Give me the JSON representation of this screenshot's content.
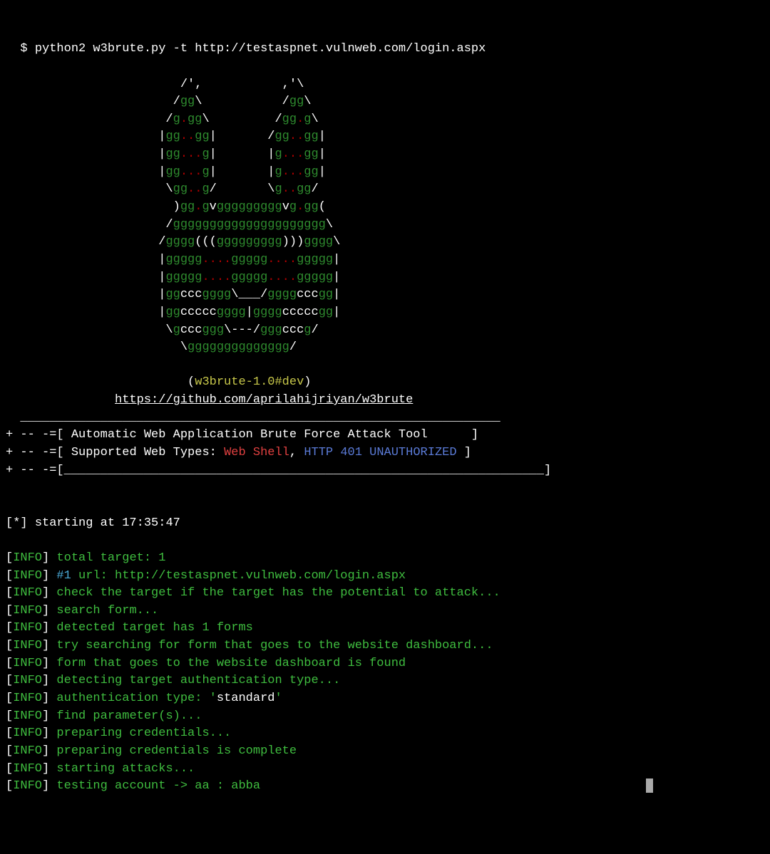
{
  "cmd": {
    "prompt": "  $ ",
    "command": "python2 w3brute.py -t http://testaspnet.vulnweb.com/login.aspx"
  },
  "ascii": {
    "line00_pre": "                        /',           ,'\\",
    "line01_pre": "                       /",
    "line01_g1": "gg",
    "line01_mid": "\\           /",
    "line01_g2": "gg",
    "line01_post": "\\",
    "line02_pre": "                      /",
    "line02_g1": "g",
    "line02_r1": ".",
    "line02_g2": "gg",
    "line02_mid": "\\         /",
    "line02_g3": "gg",
    "line02_r2": ".",
    "line02_g4": "g",
    "line02_post": "\\",
    "line03_pre": "                     |",
    "line03_g1": "gg",
    "line03_r1": "..",
    "line03_g2": "gg",
    "line03_mid": "|       /",
    "line03_g3": "gg",
    "line03_r2": "..",
    "line03_g4": "gg",
    "line03_post": "|",
    "line04_pre": "                     |",
    "line04_g1": "gg",
    "line04_r1": "...",
    "line04_g2": "g",
    "line04_mid": "|       |",
    "line04_g3": "g",
    "line04_r2": "...",
    "line04_g4": "gg",
    "line04_post": "|",
    "line05_pre": "                     |",
    "line05_g1": "gg",
    "line05_r1": "...",
    "line05_g2": "g",
    "line05_mid": "|       |",
    "line05_g3": "g",
    "line05_r2": "...",
    "line05_g4": "gg",
    "line05_post": "|",
    "line06_pre": "                      \\",
    "line06_g1": "gg",
    "line06_r1": "..",
    "line06_g2": "g",
    "line06_mid": "/       \\",
    "line06_g3": "g",
    "line06_r2": "..",
    "line06_g4": "gg",
    "line06_post": "/",
    "line07_pre": "                       )",
    "line07_g1": "gg",
    "line07_r1": ".",
    "line07_g2": "g",
    "line07_v1": "v",
    "line07_g3": "ggggggggg",
    "line07_v2": "v",
    "line07_g4": "g",
    "line07_r2": ".",
    "line07_g5": "gg",
    "line07_post": "(",
    "line08_pre": "                      /",
    "line08_g1": "ggggggggggggggggggggg",
    "line08_post": "\\",
    "line09_pre": "                     /",
    "line09_g1": "gggg",
    "line09_mid1": "(((",
    "line09_g2": "ggggggggg",
    "line09_mid2": ")))",
    "line09_g3": "gggg",
    "line09_post": "\\",
    "line10_pre": "                     |",
    "line10_g1": "ggggg",
    "line10_r1": "....",
    "line10_g2": "ggggg",
    "line10_r2": "....",
    "line10_g3": "ggggg",
    "line10_post": "|",
    "line11_pre": "                     |",
    "line11_g1": "ggggg",
    "line11_r1": "....",
    "line11_g2": "ggggg",
    "line11_r2": "....",
    "line11_g3": "ggggg",
    "line11_post": "|",
    "line12_pre": "                     |",
    "line12_g1": "gg",
    "line12_c1": "ccc",
    "line12_g2": "gggg",
    "line12_mid": "\\___/",
    "line12_g3": "gggg",
    "line12_c2": "ccc",
    "line12_g4": "gg",
    "line12_post": "|",
    "line13_pre": "                     |",
    "line13_g1": "gg",
    "line13_c1": "ccccc",
    "line13_g2": "gggg",
    "line13_mid": "|",
    "line13_g3": "gggg",
    "line13_c2": "ccccc",
    "line13_g4": "gg",
    "line13_post": "|",
    "line14_pre": "                      \\",
    "line14_g1": "g",
    "line14_c1": "ccc",
    "line14_g2": "ggg",
    "line14_mid": "\\---/",
    "line14_g3": "ggg",
    "line14_c2": "ccc",
    "line14_g4": "g",
    "line14_post": "/",
    "line15_pre": "                        \\",
    "line15_g1": "gggggggggggggg",
    "line15_post": "/"
  },
  "banner": {
    "open": "                         (",
    "ver": "w3brute-1.0#dev",
    "close": ")",
    "url_pad": "               ",
    "url": "https://github.com/aprilahijriyan/w3brute",
    "divider_top_pre": "  ",
    "divider_top": "__________________________________________________________________",
    "box_pre": "+ -- -=[ ",
    "box1_text": "Automatic Web Application Brute Force Attack Tool      ",
    "box_end": "]",
    "box2_text": "Supported Web Types: ",
    "web_shell": "Web Shell",
    "comma": ", ",
    "http401": "HTTP 401 UNAUTHORIZED",
    "space_end": " ",
    "box3_pre": "+ -- -=[",
    "box3_line": "__________________________________________________________________",
    "box3_end": "]"
  },
  "start": {
    "star": "[*] ",
    "text": "starting at ",
    "time": "17:35:47"
  },
  "log": [
    {
      "msg": "total target: 1"
    },
    {
      "pre": "",
      "hash": "#1",
      "msg": " url: http://testaspnet.vulnweb.com/login.aspx"
    },
    {
      "msg": "check the target if the target has the potential to attack..."
    },
    {
      "msg": "search form..."
    },
    {
      "msg": "detected target has 1 forms"
    },
    {
      "msg": "try searching for form that goes to the website dashboard..."
    },
    {
      "msg": "form that goes to the website dashboard is found"
    },
    {
      "msg": "detecting target authentication type..."
    },
    {
      "pre": "authentication type: '",
      "white": "standard",
      "post": "'"
    },
    {
      "msg": "find parameter(s)..."
    },
    {
      "msg": "preparing credentials..."
    },
    {
      "msg": "preparing credentials is complete"
    },
    {
      "msg": "starting attacks..."
    },
    {
      "msg": "testing account -> aa : abba"
    }
  ],
  "labels": {
    "info": "INFO",
    "lb": "[",
    "rb": "] "
  }
}
